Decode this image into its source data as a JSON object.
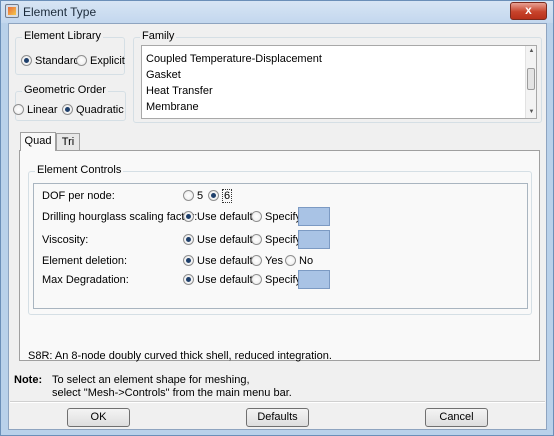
{
  "window": {
    "title": "Element Type",
    "close_glyph": "x"
  },
  "element_library": {
    "title": "Element Library",
    "options": [
      {
        "label": "Standard",
        "checked": true
      },
      {
        "label": "Explicit",
        "checked": false
      }
    ]
  },
  "geometric_order": {
    "title": "Geometric Order",
    "options": [
      {
        "label": "Linear",
        "checked": false
      },
      {
        "label": "Quadratic",
        "checked": true
      }
    ]
  },
  "family": {
    "title": "Family",
    "items": [
      "Coupled Temperature-Displacement",
      "Gasket",
      "Heat Transfer",
      "Membrane"
    ],
    "scroll_up": "▲",
    "scroll_down": "▼"
  },
  "tabs": [
    {
      "label": "Quad",
      "active": true
    },
    {
      "label": "Tri",
      "active": false
    }
  ],
  "element_controls": {
    "title": "Element Controls",
    "dof": {
      "label": "DOF per node:",
      "options": [
        "5",
        "6"
      ],
      "selected": "6"
    },
    "drilling": {
      "label": "Drilling hourglass scaling factor:",
      "use_default": "Use default",
      "specify": "Specify"
    },
    "viscosity": {
      "label": "Viscosity:",
      "use_default": "Use default",
      "specify": "Specify"
    },
    "deletion": {
      "label": "Element deletion:",
      "use_default": "Use default",
      "yes": "Yes",
      "no": "No"
    },
    "max_degradation": {
      "label": "Max Degradation:",
      "use_default": "Use default",
      "specify": "Specify"
    },
    "spec_color": "#a9c3e5"
  },
  "description": "S8R:  An 8-node doubly curved thick shell, reduced integration.",
  "note": {
    "label": "Note:",
    "line1": "To select an element shape for meshing,",
    "line2": "select \"Mesh->Controls\" from the main menu bar."
  },
  "buttons": {
    "ok": "OK",
    "defaults": "Defaults",
    "cancel": "Cancel"
  }
}
